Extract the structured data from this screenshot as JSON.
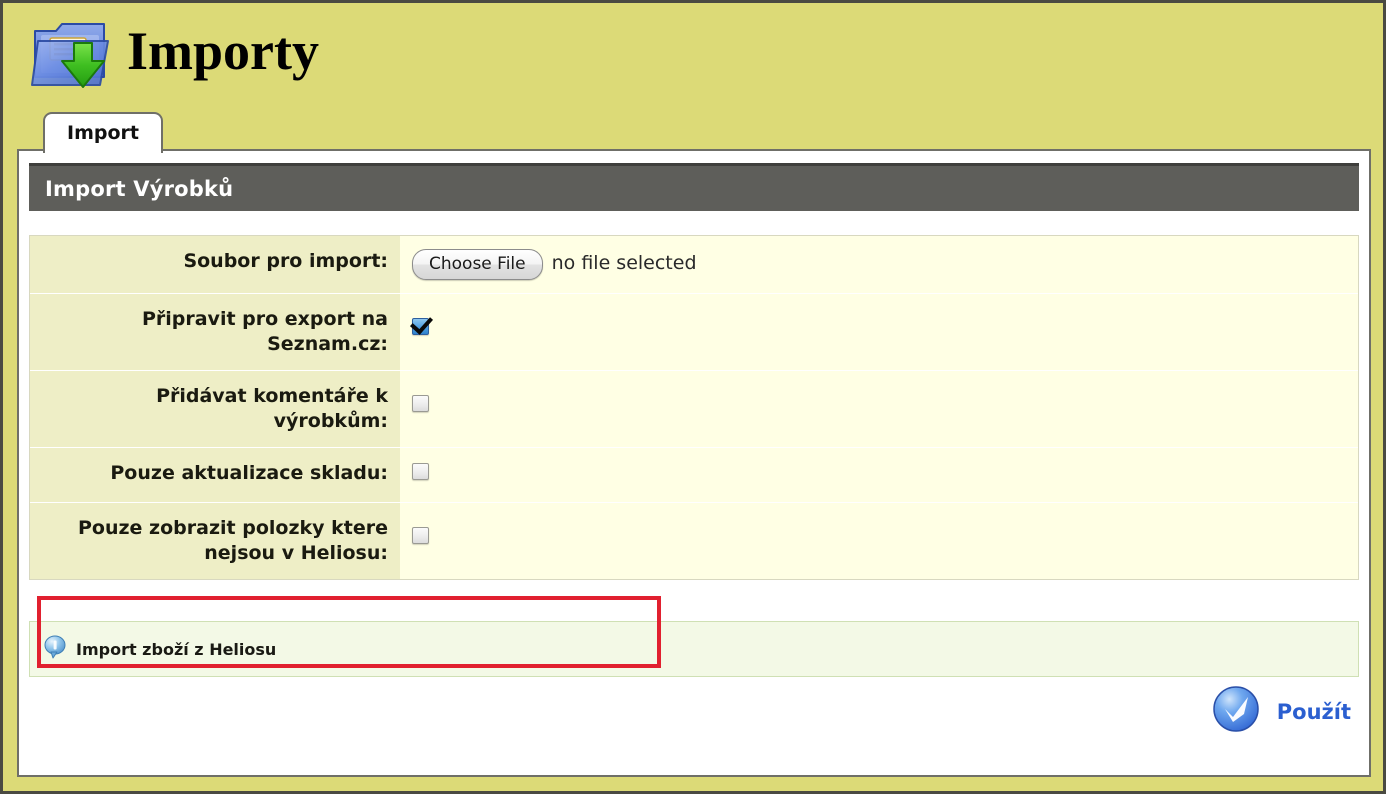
{
  "header": {
    "title": "Importy",
    "icon": "import-folder-icon"
  },
  "tabs": [
    {
      "label": "Import",
      "active": true
    }
  ],
  "section": {
    "title": "Import Výrobků"
  },
  "form": {
    "rows": [
      {
        "label": "Soubor pro import:",
        "type": "file",
        "button_label": "Choose File",
        "status": "no file selected"
      },
      {
        "label": "Připravit pro export na Seznam.cz:",
        "type": "checkbox",
        "checked": true
      },
      {
        "label": "Přidávat komentáře k výrobkům:",
        "type": "checkbox",
        "checked": false
      },
      {
        "label": "Pouze aktualizace skladu:",
        "type": "checkbox",
        "checked": false,
        "highlighted": true
      },
      {
        "label": "Pouze zobrazit polozky ktere nejsou v Heliosu:",
        "type": "checkbox",
        "checked": false
      }
    ]
  },
  "note": {
    "icon": "info-balloon-icon",
    "text": "Import zboží z Heliosu"
  },
  "submit": {
    "icon": "blue-check-circle-icon",
    "label": "Použít"
  },
  "annotation": {
    "color": "#e1202f",
    "target": "Pouze aktualizace skladu:"
  },
  "colors": {
    "page_background": "#dcda77",
    "panel_background": "#ffffff",
    "section_bar": "#5e5e5a",
    "label_cell": "#eeeec6",
    "value_cell": "#ffffe4",
    "note_background": "#f3f9e6",
    "accent_link": "#2b5fd0",
    "annotation_red": "#e1202f"
  }
}
